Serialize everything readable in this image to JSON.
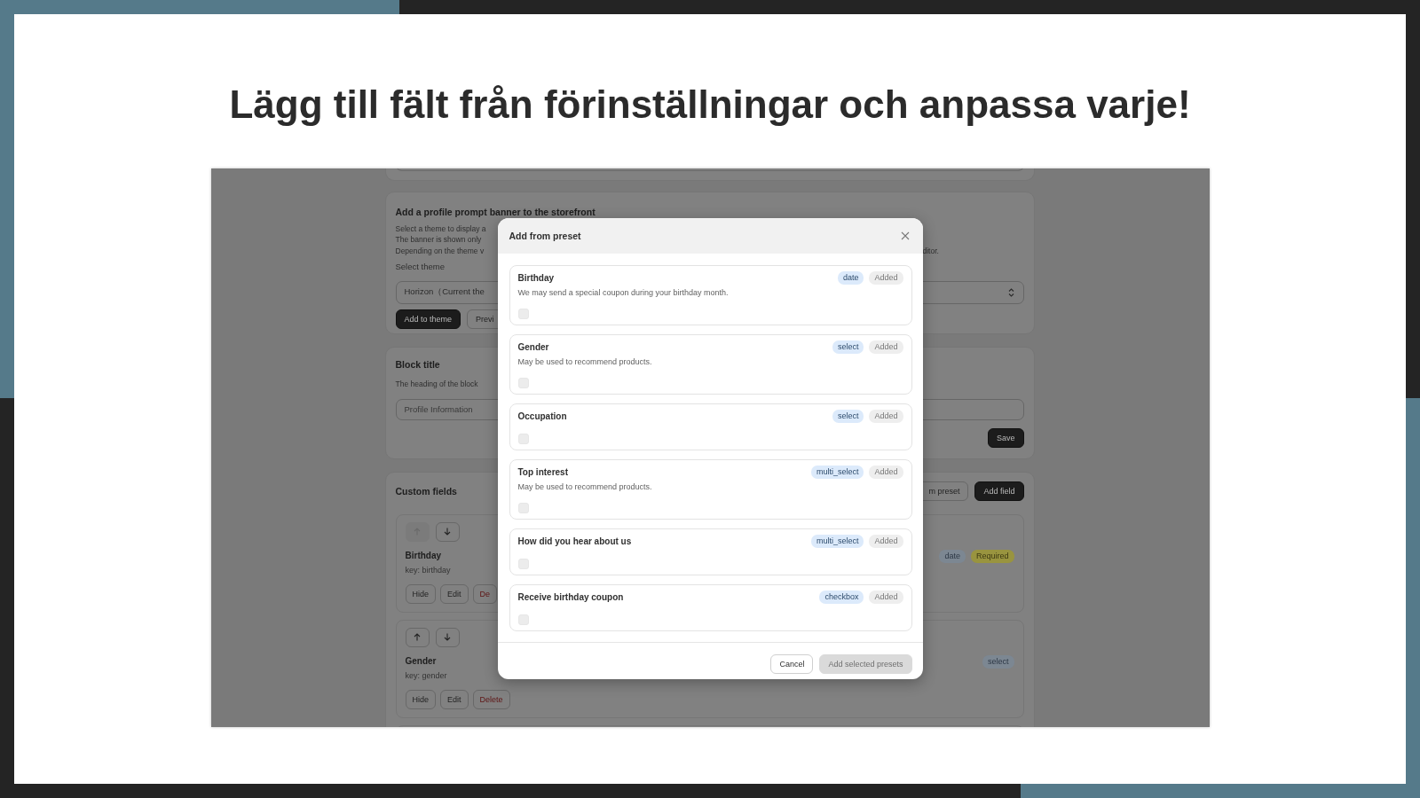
{
  "slide": {
    "title": "Lägg till fält från förinställningar och anpassa varje!"
  },
  "background_page": {
    "banner_card": {
      "title": "Add a profile prompt banner to the storefront",
      "description_lines": [
        {
          "text": "Select a theme to display a"
        },
        {
          "text": "The banner is shown only"
        },
        {
          "text": "Depending on the theme v",
          "continuation": "ditor."
        }
      ],
      "select_label": "Select theme",
      "select_value": "Horizon（Current the",
      "buttons": [
        {
          "label": "Add to theme",
          "kind": "primary"
        },
        {
          "label": "Previ",
          "kind": "secondary"
        }
      ]
    },
    "block_title_card": {
      "title": "Block title",
      "description": "The heading of the block",
      "input_value": "Profile Information",
      "save_button": "Save"
    },
    "custom_fields_card": {
      "title": "Custom fields",
      "buttons": [
        {
          "label": "m preset",
          "kind": "secondary"
        },
        {
          "label": "Add field",
          "kind": "primary"
        }
      ],
      "fields": [
        {
          "name": "Birthday",
          "key": "key: birthday",
          "up_disabled": true,
          "actions": [
            {
              "label": "Hide",
              "kind": "normal"
            },
            {
              "label": "Edit",
              "kind": "normal"
            },
            {
              "label": "De",
              "kind": "danger"
            }
          ],
          "tags": [
            {
              "label": "date",
              "kind": "type"
            },
            {
              "label": "Required",
              "kind": "required"
            }
          ]
        },
        {
          "name": "Gender",
          "key": "key: gender",
          "up_disabled": false,
          "actions": [
            {
              "label": "Hide",
              "kind": "normal"
            },
            {
              "label": "Edit",
              "kind": "normal"
            },
            {
              "label": "Delete",
              "kind": "danger"
            }
          ],
          "tags": [
            {
              "label": "select",
              "kind": "type"
            }
          ]
        }
      ]
    }
  },
  "modal": {
    "title": "Add from preset",
    "presets": [
      {
        "name": "Birthday",
        "type": "date",
        "status": "Added",
        "description": "We may send a special coupon during your birthday month.",
        "checked": false,
        "disabled": true
      },
      {
        "name": "Gender",
        "type": "select",
        "status": "Added",
        "description": "May be used to recommend products.",
        "checked": false,
        "disabled": true
      },
      {
        "name": "Occupation",
        "type": "select",
        "status": "Added",
        "checked": false,
        "disabled": true
      },
      {
        "name": "Top interest",
        "type": "multi_select",
        "status": "Added",
        "description": "May be used to recommend products.",
        "checked": false,
        "disabled": true
      },
      {
        "name": "How did you hear about us",
        "type": "multi_select",
        "status": "Added",
        "checked": false,
        "disabled": true
      },
      {
        "name": "Receive birthday coupon",
        "type": "checkbox",
        "status": "Added",
        "checked": false,
        "disabled": true
      }
    ],
    "buttons": [
      {
        "label": "Cancel",
        "kind": "secondary",
        "disabled": false
      },
      {
        "label": "Add selected presets",
        "kind": "primary",
        "disabled": true
      }
    ]
  }
}
